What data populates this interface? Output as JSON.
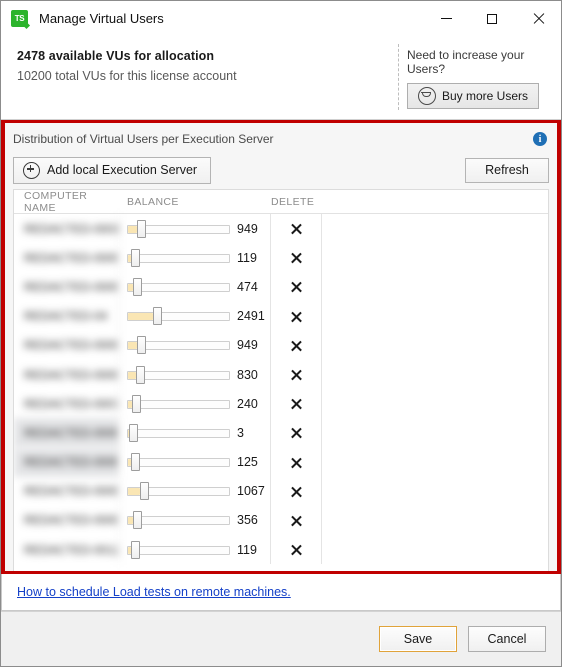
{
  "window": {
    "title": "Manage Virtual Users",
    "app_icon": "ts-logo-icon",
    "minimize_label": "Minimize",
    "maximize_label": "Maximize",
    "close_label": "Close"
  },
  "summary": {
    "available_text": "2478 available VUs for allocation",
    "total_text": "10200 total VUs for this license account",
    "increase_label": "Need to increase your Users?",
    "buy_button": "Buy more Users",
    "buy_icon": "shopping-cart-icon"
  },
  "panel": {
    "title": "Distribution of Virtual Users per Execution Server",
    "info_icon": "info-icon",
    "info_glyph": "i",
    "add_server_button": "Add local Execution Server",
    "add_icon": "plus-circle-icon",
    "refresh_button": "Refresh"
  },
  "grid": {
    "columns": [
      "COMPUTER NAME",
      "BALANCE",
      "DELETE"
    ],
    "delete_icon": "close-x-icon",
    "rows": [
      {
        "name": "REDACTED-0001",
        "balance": "949",
        "slider_pct": 11,
        "selected": false
      },
      {
        "name": "REDACTED-000002",
        "balance": "119",
        "slider_pct": 4,
        "selected": false
      },
      {
        "name": "REDACTED-000003",
        "balance": "474",
        "slider_pct": 6,
        "selected": false
      },
      {
        "name": "REDACTED-04",
        "balance": "2491",
        "slider_pct": 28,
        "selected": false
      },
      {
        "name": "REDACTED-000005",
        "balance": "949",
        "slider_pct": 11,
        "selected": false
      },
      {
        "name": "REDACTED-00006",
        "balance": "830",
        "slider_pct": 10,
        "selected": false
      },
      {
        "name": "REDACTED-0007",
        "balance": "240",
        "slider_pct": 5,
        "selected": false
      },
      {
        "name": "REDACTED-000008",
        "balance": "3",
        "slider_pct": 2,
        "selected": true
      },
      {
        "name": "REDACTED-000009",
        "balance": "125",
        "slider_pct": 4,
        "selected": true
      },
      {
        "name": "REDACTED-000010",
        "balance": "1067",
        "slider_pct": 14,
        "selected": false
      },
      {
        "name": "REDACTED-000011",
        "balance": "356",
        "slider_pct": 6,
        "selected": false
      },
      {
        "name": "REDACTED-0012",
        "balance": "119",
        "slider_pct": 4,
        "selected": false
      }
    ]
  },
  "footer": {
    "help_link": "How to schedule Load tests on remote machines.",
    "save_button": "Save",
    "cancel_button": "Cancel"
  },
  "colors": {
    "accent_highlight": "#c00000",
    "slider_fill": "#fae6b4",
    "link": "#1440c8",
    "info_blue": "#1f6fb5",
    "app_green": "#2cb42c",
    "default_button_border": "#e0a33a"
  }
}
